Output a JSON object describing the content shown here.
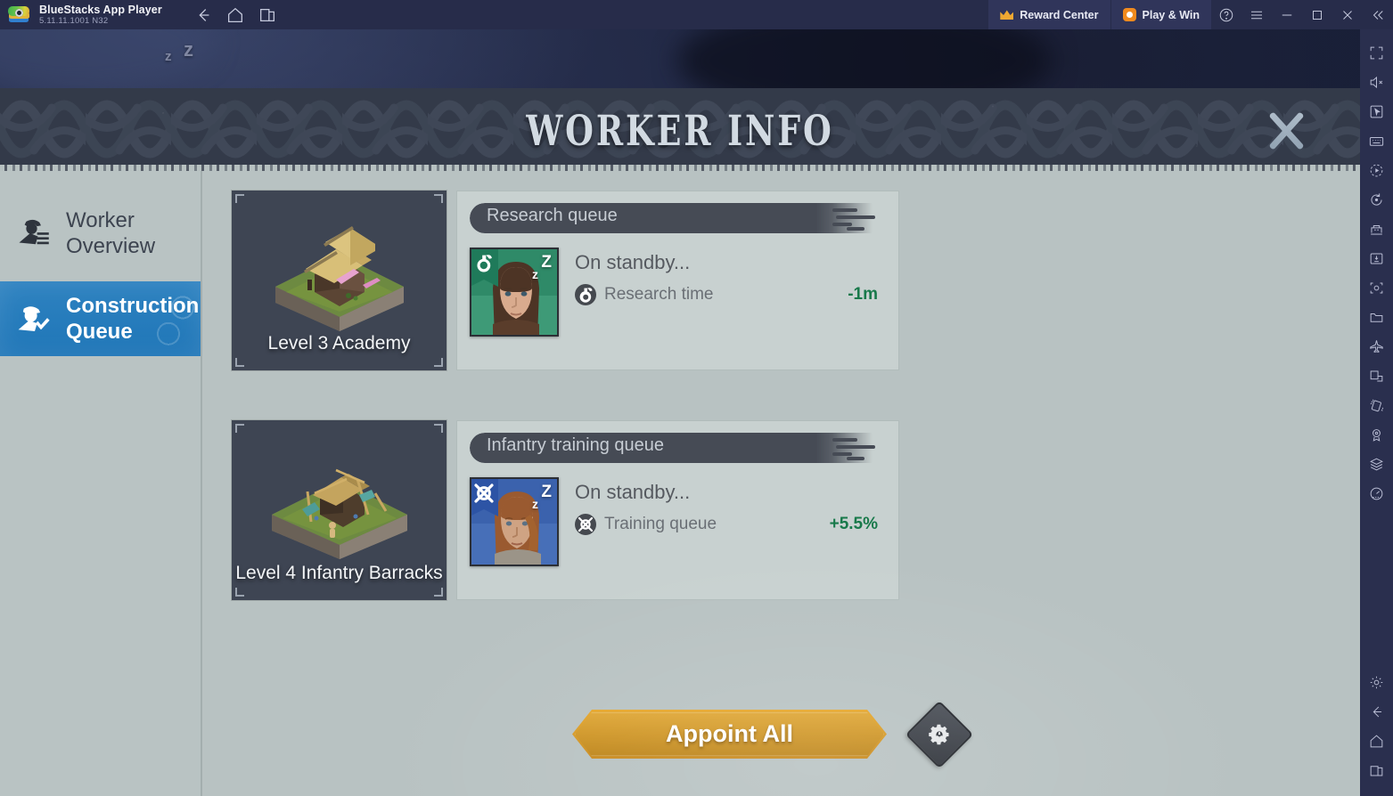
{
  "titlebar": {
    "app_name": "BlueStacks App Player",
    "version": "5.11.11.1001  N32",
    "nav": [
      {
        "name": "back-button",
        "icon": "back-arrow-icon"
      },
      {
        "name": "home-button",
        "icon": "home-icon"
      },
      {
        "name": "recents-button",
        "icon": "multi-window-icon"
      }
    ],
    "reward_center_label": "Reward Center",
    "play_and_win_label": "Play & Win",
    "window_controls": [
      "help-icon",
      "hamburger-menu-icon",
      "minimize-icon",
      "maximize-icon",
      "close-icon",
      "collapse-icon"
    ]
  },
  "modal": {
    "title": "WORKER INFO",
    "close_label": "X"
  },
  "sidebar": {
    "items": [
      {
        "label": "Worker Overview",
        "icon": "worker-list-icon",
        "active": false
      },
      {
        "label": "Construction Queue",
        "icon": "worker-check-icon",
        "active": true
      }
    ]
  },
  "rows": [
    {
      "building_name": "Level 3 Academy",
      "queue_title": "Research queue",
      "status": "On standby...",
      "stat_label": "Research time",
      "stat_value": "-1m",
      "stat_color": "#18794a",
      "portrait_theme": "#2e8a66",
      "emblem": "research-flask-icon",
      "sleep_marks": [
        "z",
        "Z"
      ]
    },
    {
      "building_name": "Level 4 Infantry Barracks",
      "queue_title": "Infantry training queue",
      "status": "On standby...",
      "stat_label": "Training queue",
      "stat_value": "+5.5%",
      "stat_color": "#18794a",
      "portrait_theme": "#3b62ad",
      "emblem": "crossed-swords-icon",
      "sleep_marks": [
        "z",
        "Z"
      ]
    }
  ],
  "actions": {
    "appoint_all_label": "Appoint All",
    "settings_icon": "gear-icon"
  },
  "rail": {
    "icons": [
      "fullscreen-icon",
      "mute-icon",
      "pointer-icon",
      "keyboard-icon",
      "macro-record-icon",
      "rotate-icon",
      "multi-instance-icon",
      "install-apk-icon",
      "screenshot-icon",
      "media-folder-icon",
      "airplane-mode-icon",
      "window-resize-icon",
      "shake-icon",
      "location-icon",
      "layers-icon",
      "speedometer-icon"
    ],
    "bottom_icons": [
      "gear-icon",
      "back-arrow-icon",
      "home-icon",
      "recents-icon"
    ]
  },
  "colors": {
    "accent_blue": "#1f76b8",
    "gold": "#d79a24",
    "panel_bg": "#b8c2c2",
    "header_dark": "#333a49",
    "positive_green": "#18794a"
  }
}
